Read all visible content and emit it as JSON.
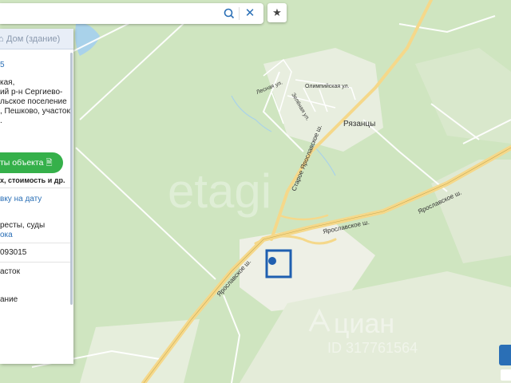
{
  "search": {
    "placeholder": ""
  },
  "panel": {
    "header": "Дом (здание)",
    "lines": [
      "5",
      "кая,",
      "ий р-н Сергиево-",
      "льское поселение",
      ", Пешково, участок",
      "."
    ],
    "button_label": "ты объекта",
    "button_sub": "х, стоимость и др.",
    "date_link": "вку на дату",
    "arrests": "ресты, суды",
    "arrests_link": "ока",
    "number": "093015",
    "item1": "асток",
    "item2": "ание"
  },
  "map": {
    "labels": {
      "lesnaya": "Лесная ул.",
      "olimpiyskaya": "Олимпийская ул.",
      "zelenaya": "Зелёная ул.",
      "ryazantsy": "Рязанцы",
      "staroe_yaroslavskoe": "Старое Ярославское ш.",
      "yaroslavskoe1": "Ярославское ш.",
      "yaroslavskoe2": "Ярославское ш.",
      "yaroslavskoe3": "Ярославское ш.",
      "watermark_cian": "циан",
      "watermark_id": "ID 317761564",
      "watermark_etag": "etagi"
    },
    "colors": {
      "forest": "#cfe5c0",
      "field": "#f0f0e6",
      "road_major": "#f5d88a",
      "water": "#a9d2ea",
      "marker": "#1f5fb0"
    }
  },
  "icons": {
    "search": "search-icon",
    "clear": "close-icon",
    "favorite": "star-icon",
    "home": "home-icon",
    "document": "document-icon"
  }
}
